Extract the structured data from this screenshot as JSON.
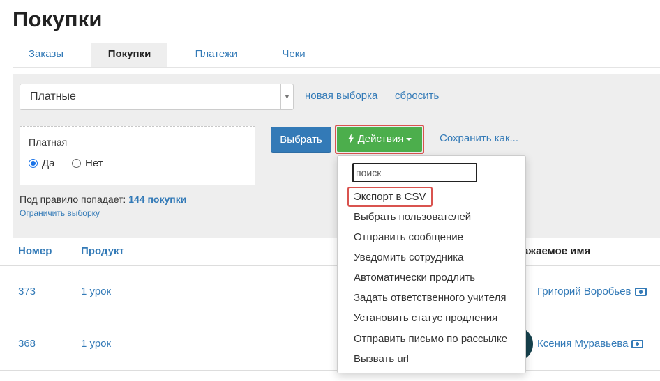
{
  "page": {
    "title": "Покупки"
  },
  "tabs": [
    {
      "label": "Заказы",
      "active": false
    },
    {
      "label": "Покупки",
      "active": true
    },
    {
      "label": "Платежи",
      "active": false
    },
    {
      "label": "Чеки",
      "active": false
    }
  ],
  "filter": {
    "select_value": "Платные",
    "new_selection": "новая выборка",
    "reset": "сбросить",
    "rule": {
      "label": "Платная",
      "options": [
        {
          "label": "Да",
          "checked": true
        },
        {
          "label": "Нет",
          "checked": false
        }
      ]
    },
    "count_prefix": "Под правило попадает:",
    "count_value": "144 покупки",
    "limit_link": "Ограничить выборку",
    "select_button": "Выбрать",
    "actions_button": "Действия",
    "save_as": "Сохранить как..."
  },
  "dropdown": {
    "search_placeholder": "поиск",
    "items": [
      "Экспорт в CSV",
      "Выбрать пользователей",
      "Отправить сообщение",
      "Уведомить сотрудника",
      "Автоматически продлить",
      "Задать ответственного учителя",
      "Установить статус продления",
      "Отправить письмо по рассылке",
      "Вызвать url"
    ]
  },
  "table": {
    "columns": [
      "Номер",
      "Продукт",
      "важаемое имя"
    ],
    "rows": [
      {
        "number": "373",
        "product": "1 урок",
        "name": "Григорий Воробьев"
      },
      {
        "number": "368",
        "product": "1 урок",
        "name": "Ксения Муравьева"
      }
    ]
  },
  "colors": {
    "link": "#337ab7",
    "primary_button": "#337ab7",
    "success_button": "#4cae4c",
    "highlight": "#d9534f",
    "panel": "#eeeeee"
  },
  "icons": {
    "actions": "lightning-bolt-icon",
    "caret": "caret-down-icon",
    "customer": "card-icon"
  }
}
